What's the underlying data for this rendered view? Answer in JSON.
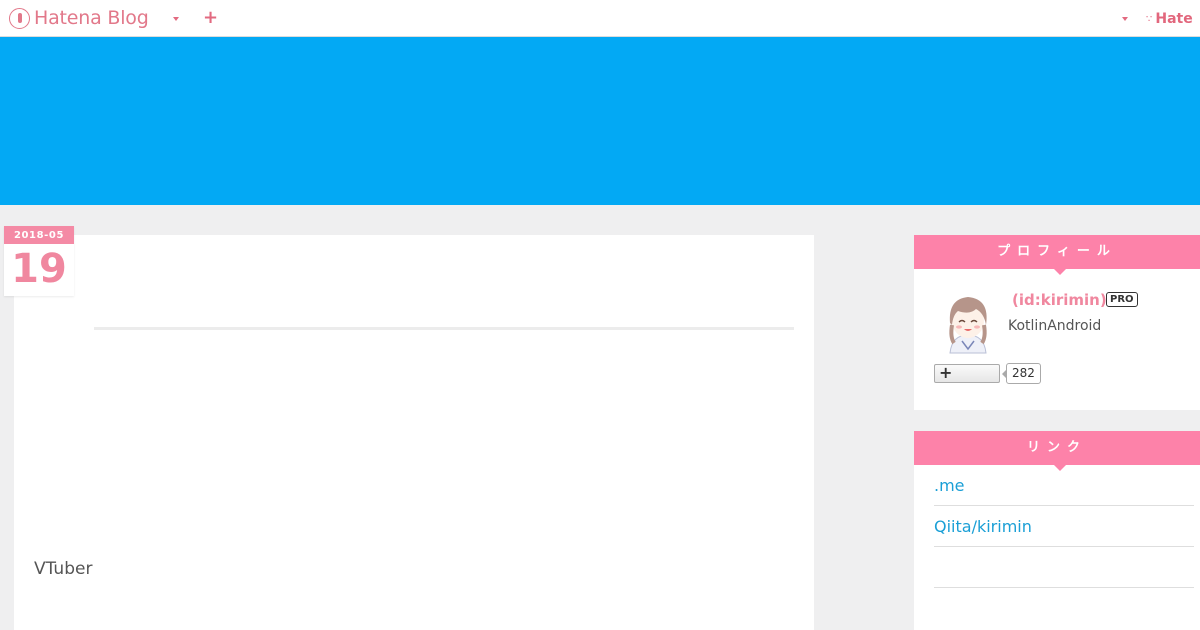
{
  "topbar": {
    "brand": "Hatena Blog",
    "right_brand": "Hate"
  },
  "article": {
    "date_ym": "2018-05",
    "date_day": "19",
    "tag": "VTuber"
  },
  "sidebar": {
    "profile": {
      "title": "プロフィール",
      "id": "(id:kirimin)",
      "badge": "PRO",
      "description": "KotlinAndroid",
      "follow_count": "282"
    },
    "links": {
      "title": "リンク",
      "items": [
        {
          "label": ".me"
        },
        {
          "label": "Qiita/kirimin"
        },
        {
          "label": ""
        }
      ]
    }
  },
  "colors": {
    "brand_pink": "#e2788a",
    "banner_blue": "#03a9f4",
    "module_pink": "#fd82a9",
    "link_blue": "#1a9fd6"
  }
}
